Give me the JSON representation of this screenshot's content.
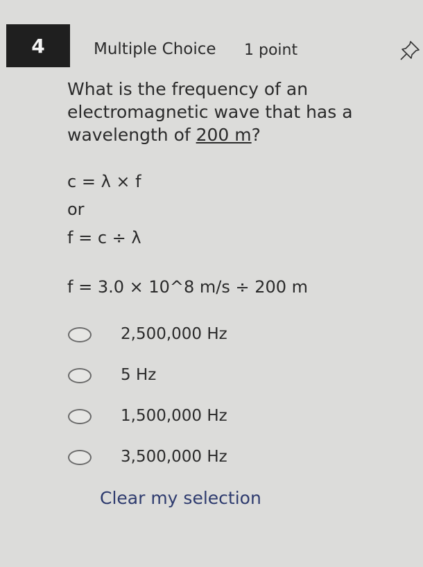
{
  "question": {
    "number": "4",
    "type": "Multiple Choice",
    "points": "1 point",
    "text_before": "What is the frequency of an electromagnetic wave that has a wavelength of ",
    "text_underlined": "200 m",
    "text_after": "?"
  },
  "formulas": {
    "line1": "c = λ × f",
    "or": "or",
    "line2": "f = c ÷ λ",
    "calc": "f = 3.0 × 10^8 m/s ÷ 200 m"
  },
  "options": [
    {
      "label": "2,500,000 Hz"
    },
    {
      "label": "5 Hz"
    },
    {
      "label": "1,500,000 Hz"
    },
    {
      "label": "3,500,000 Hz"
    }
  ],
  "clear_label": "Clear my selection",
  "icons": {
    "pin": "pin-icon"
  }
}
